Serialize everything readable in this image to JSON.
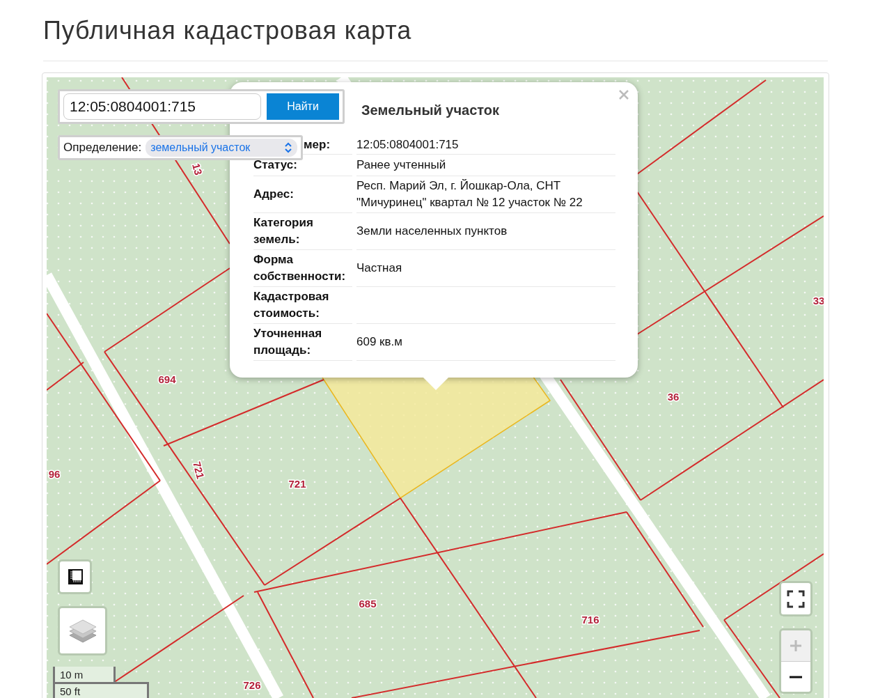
{
  "page_title": "Публичная кадастровая карта",
  "search": {
    "value": "12:05:0804001:715",
    "button": "Найти"
  },
  "definition": {
    "label": "Определение:",
    "value": "земельный участок"
  },
  "popup": {
    "title": "Земельный участок",
    "rows": [
      {
        "label": "мер:",
        "value": "12:05:0804001:715"
      },
      {
        "label": "Статус:",
        "value": "Ранее учтенный"
      },
      {
        "label": "Адрес:",
        "value": "Респ. Марий Эл, г. Йошкар-Ола, СНТ \"Мичуринец\" квартал № 12 участок № 22"
      },
      {
        "label": "Категория земель:",
        "value": "Земли населенных пунктов"
      },
      {
        "label": "Форма собственности:",
        "value": "Частная"
      },
      {
        "label": "Кадастровая стоимость:"
      },
      {
        "label": "Уточненная площадь:",
        "value": "609 кв.м"
      }
    ]
  },
  "map_labels": [
    {
      "text": "13",
      "rotated": true
    },
    {
      "text": "694",
      "rotated": false
    },
    {
      "text": "96",
      "rotated": false
    },
    {
      "text": "721",
      "rotated": true
    },
    {
      "text": "721",
      "rotated": false
    },
    {
      "text": "685",
      "rotated": false
    },
    {
      "text": "716",
      "rotated": false
    },
    {
      "text": "726",
      "rotated": false
    },
    {
      "text": "36",
      "rotated": false
    },
    {
      "text": "33",
      "rotated": false
    }
  ],
  "scale": [
    "10 m",
    "50 ft"
  ],
  "zoom": {
    "zoom_in_disabled": true
  }
}
